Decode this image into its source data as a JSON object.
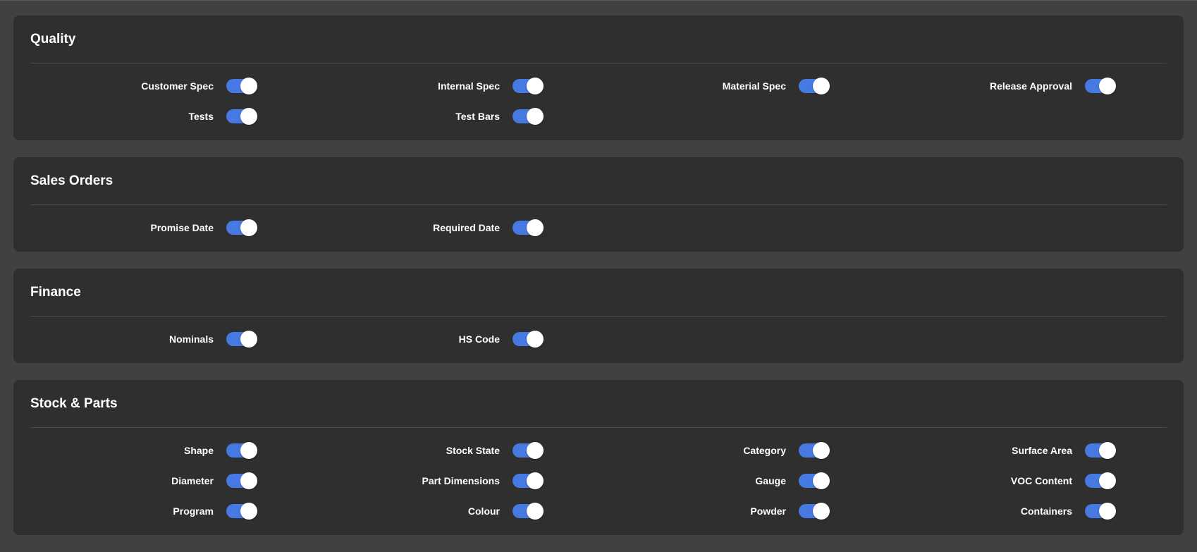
{
  "colors": {
    "page_background": "#414141",
    "card_background": "#2f2f2f",
    "toggle_on": "#4779e3",
    "toggle_knob": "#ffffff"
  },
  "sections": [
    {
      "title": "Quality",
      "toggles": [
        {
          "label": "Customer Spec",
          "on": true
        },
        {
          "label": "Internal Spec",
          "on": true
        },
        {
          "label": "Material Spec",
          "on": true
        },
        {
          "label": "Release Approval",
          "on": true
        },
        {
          "label": "Tests",
          "on": true
        },
        {
          "label": "Test Bars",
          "on": true
        }
      ]
    },
    {
      "title": "Sales Orders",
      "toggles": [
        {
          "label": "Promise Date",
          "on": true
        },
        {
          "label": "Required Date",
          "on": true
        }
      ]
    },
    {
      "title": "Finance",
      "toggles": [
        {
          "label": "Nominals",
          "on": true
        },
        {
          "label": "HS Code",
          "on": true
        }
      ]
    },
    {
      "title": "Stock & Parts",
      "toggles": [
        {
          "label": "Shape",
          "on": true
        },
        {
          "label": "Stock State",
          "on": true
        },
        {
          "label": "Category",
          "on": true
        },
        {
          "label": "Surface Area",
          "on": true
        },
        {
          "label": "Diameter",
          "on": true
        },
        {
          "label": "Part Dimensions",
          "on": true
        },
        {
          "label": "Gauge",
          "on": true
        },
        {
          "label": "VOC Content",
          "on": true
        },
        {
          "label": "Program",
          "on": true
        },
        {
          "label": "Colour",
          "on": true
        },
        {
          "label": "Powder",
          "on": true
        },
        {
          "label": "Containers",
          "on": true
        }
      ]
    }
  ]
}
